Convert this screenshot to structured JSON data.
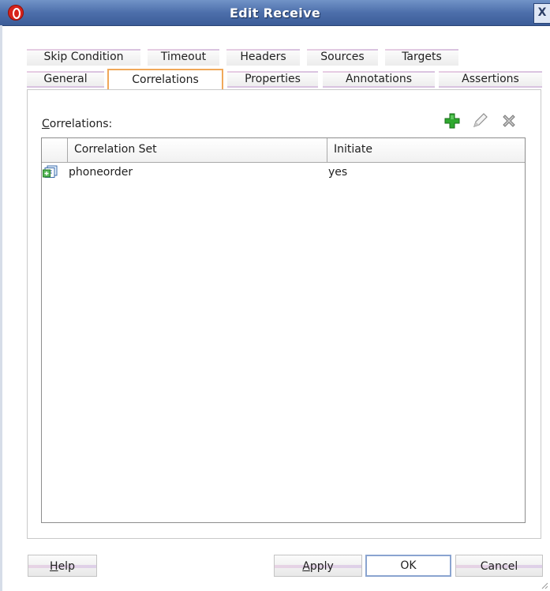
{
  "window": {
    "title": "Edit Receive",
    "close_label": "X"
  },
  "tabs": {
    "row1": [
      {
        "label": "Skip Condition"
      },
      {
        "label": "Timeout"
      },
      {
        "label": "Headers"
      },
      {
        "label": "Sources"
      },
      {
        "label": "Targets"
      }
    ],
    "row2": [
      {
        "label": "General"
      },
      {
        "label": "Correlations",
        "active": true
      },
      {
        "label": "Properties"
      },
      {
        "label": "Annotations"
      },
      {
        "label": "Assertions"
      }
    ]
  },
  "correlations": {
    "label_mnemonic": "C",
    "label_rest": "orrelations:",
    "toolbar_icons": [
      "add-icon",
      "edit-icon",
      "delete-icon"
    ],
    "columns": [
      "Correlation Set",
      "Initiate"
    ],
    "rows": [
      {
        "icon": "correlation-set-icon",
        "correlation_set": "phoneorder",
        "initiate": "yes"
      }
    ]
  },
  "buttons": {
    "help": {
      "mnemonic": "H",
      "rest": "elp"
    },
    "apply": {
      "mnemonic": "A",
      "rest": "pply"
    },
    "ok": "OK",
    "cancel": "Cancel"
  },
  "colors": {
    "title_bar": "#4d6fab",
    "active_tab_border": "#f0a85a",
    "add_icon": "#2fa82f"
  }
}
